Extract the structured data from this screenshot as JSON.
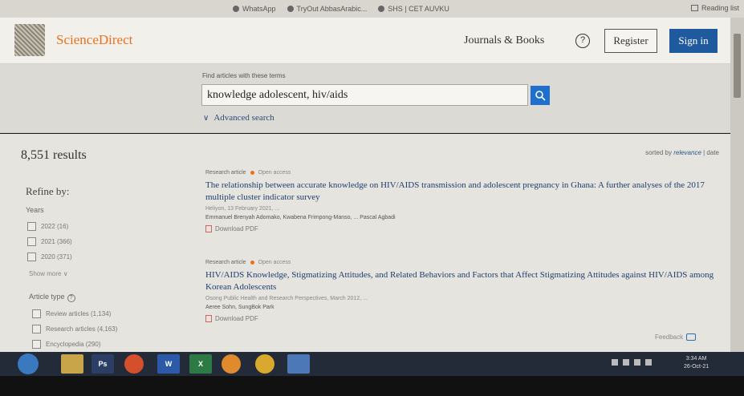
{
  "browser": {
    "bookmarks": [
      "WhatsApp",
      "TryOut AbbasArabic...",
      "SHS | CET AUVKU"
    ],
    "reading_list": "Reading list"
  },
  "header": {
    "brand": "ScienceDirect",
    "journals_books": "Journals & Books",
    "help_icon": "?",
    "register": "Register",
    "sign_in": "Sign in"
  },
  "search": {
    "label": "Find articles with these terms",
    "value": "knowledge adolescent, hiv/aids",
    "advanced": "Advanced search"
  },
  "results": {
    "count": "8,551 results",
    "sorted_by": "sorted by",
    "sort_relevance": "relevance",
    "sort_date": "date"
  },
  "refine": {
    "title": "Refine by:",
    "years_label": "Years",
    "years": [
      "2022 (16)",
      "2021 (366)",
      "2020 (371)"
    ],
    "show_more": "Show more",
    "article_type_label": "Article type",
    "article_types": [
      "Review articles (1,134)",
      "Research articles (4,163)",
      "Encyclopedia (290)"
    ]
  },
  "items": [
    {
      "type": "Research article",
      "access": "Open access",
      "title": "The relationship between accurate knowledge on HIV/AIDS transmission and adolescent pregnancy in Ghana: A further analyses of the 2017 multiple cluster indicator survey",
      "source": "Heliyon, 13 February 2021, ...",
      "authors": "Emmanuel Brenyah Adomako, Kwabena Frimpong-Manso, ... Pascal Agbadi",
      "pdf": "Download PDF"
    },
    {
      "type": "Research article",
      "access": "Open access",
      "title": "HIV/AIDS Knowledge, Stigmatizing Attitudes, and Related Behaviors and Factors that Affect Stigmatizing Attitudes against HIV/AIDS among Korean Adolescents",
      "source": "Osong Public Health and Research Perspectives, March 2012, ...",
      "authors": "Aeree Sohn, SungBok Park",
      "pdf": "Download PDF"
    }
  ],
  "feedback": "Feedback",
  "taskbar": {
    "apps": [
      "Ps",
      "W",
      "X"
    ],
    "time": "3:34 AM",
    "date": "26-Oct-21"
  }
}
